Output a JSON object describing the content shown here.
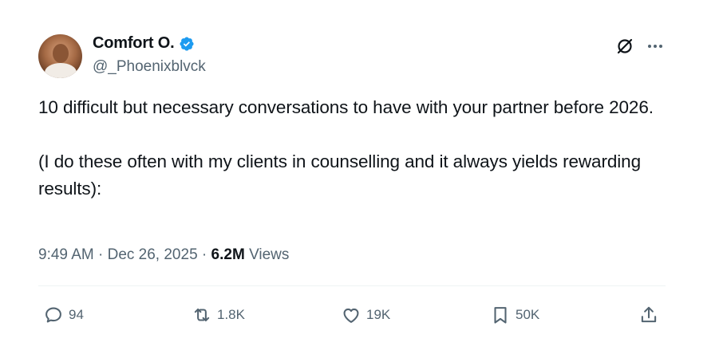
{
  "author": {
    "name": "Comfort O.",
    "handle": "@_Phoenixblvck",
    "verified": true,
    "verified_color": "#1d9bf0"
  },
  "tweet": {
    "text": "10 difficult but necessary conversations to have with your partner before 2026.\n\n(I do these often with my clients in counselling and it always yields rewarding results):"
  },
  "meta": {
    "time": "9:49 AM",
    "separator": "·",
    "date": "Dec 26, 2025",
    "views_count": "6.2M",
    "views_label": "Views"
  },
  "actions": {
    "replies": "94",
    "reposts": "1.8K",
    "likes": "19K",
    "bookmarks": "50K"
  },
  "icons": {
    "top_right": [
      "grok-icon",
      "more-icon"
    ],
    "actions": [
      "reply-icon",
      "repost-icon",
      "like-icon",
      "bookmark-icon",
      "share-icon"
    ]
  },
  "colors": {
    "text": "#0f1419",
    "secondary": "#536471",
    "divider": "#eff3f4"
  }
}
